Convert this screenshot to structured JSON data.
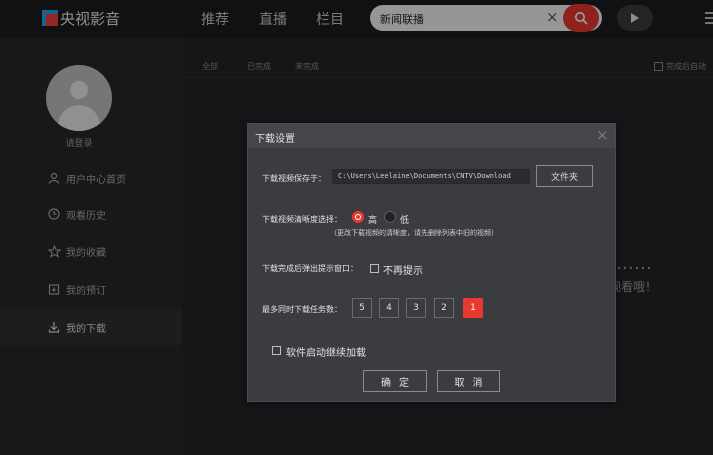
{
  "app": {
    "logo_text": "央视影音",
    "nav": [
      "推荐",
      "直播",
      "栏目"
    ],
    "search": {
      "value": "新闻联播"
    },
    "colors": {
      "accent": "#e8382f",
      "logo_blue": "#2aa1e6"
    }
  },
  "sidebar": {
    "login": "请登录",
    "items": [
      {
        "label": "用户中心首页",
        "icon": "user-icon"
      },
      {
        "label": "观看历史",
        "icon": "clock-icon"
      },
      {
        "label": "我的收藏",
        "icon": "star-icon"
      },
      {
        "label": "我的预订",
        "icon": "calendar-icon"
      },
      {
        "label": "我的下载",
        "icon": "download-icon"
      }
    ]
  },
  "main": {
    "tabs": [
      "全部",
      "已完成",
      "未完成"
    ],
    "after_complete": "完成后自动",
    "empty_line1": "D……",
    "empty_line2": "观看哦！"
  },
  "dialog": {
    "title": "下载设置",
    "save_label": "下载视频保存于：",
    "save_path": "C:\\Users\\Leelaine\\Documents\\CNTV\\Download",
    "folder_button": "文件夹",
    "quality_label": "下载视频清晰度选择：",
    "quality_high": "高",
    "quality_low": "低",
    "quality_note": "（更改下载视频的清晰度，请先删除列表中旧的视频）",
    "popup_label": "下载完成后弹出提示窗口：",
    "no_prompt": "不再提示",
    "max_tasks_label": "最多同时下载任务数：",
    "task_options": [
      "5",
      "4",
      "3",
      "2",
      "1"
    ],
    "task_selected": "1",
    "resume_label": "软件启动继续加载",
    "ok_button": "确定",
    "cancel_button": "取消"
  }
}
